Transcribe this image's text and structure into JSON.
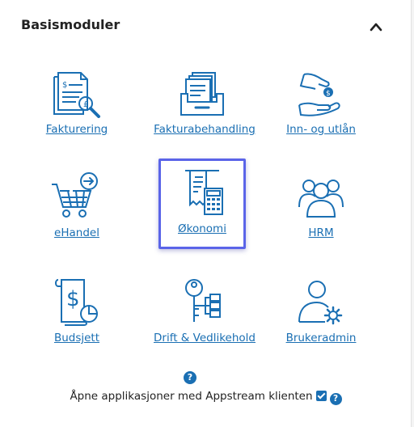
{
  "header": {
    "title": "Basismoduler"
  },
  "modules": [
    {
      "label": "Fakturering",
      "icon": "invoice-magnifier-icon"
    },
    {
      "label": "Fakturabehandling",
      "icon": "document-tray-icon"
    },
    {
      "label": "Inn- og utlån",
      "icon": "hand-coin-icon"
    },
    {
      "label": "eHandel",
      "icon": "shopping-cart-arrow-icon"
    },
    {
      "label": "Økonomi",
      "icon": "receipt-calculator-icon"
    },
    {
      "label": "HRM",
      "icon": "people-group-icon"
    },
    {
      "label": "Budsjett",
      "icon": "budget-document-pie-icon"
    },
    {
      "label": "Drift & Vedlikehold",
      "icon": "key-hierarchy-icon"
    },
    {
      "label": "Brukeradmin",
      "icon": "user-gear-icon"
    }
  ],
  "help": {
    "symbol": "?"
  },
  "footer": {
    "text": "Åpne applikasjoner med Appstream klienten",
    "checked": true,
    "help_symbol": "?"
  },
  "colors": {
    "accent": "#1a6fb3",
    "selected_border": "#5a64e8"
  }
}
